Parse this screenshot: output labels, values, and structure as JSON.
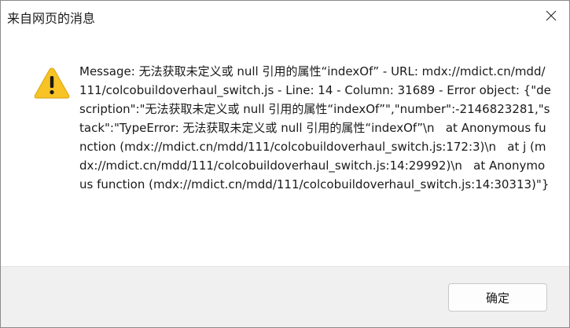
{
  "window": {
    "title": "来自网页的消息"
  },
  "icons": {
    "close": "close-icon",
    "warning": "warning-icon"
  },
  "message": {
    "text": "Message: 无法获取未定义或 null 引用的属性“indexOf” - URL: mdx://mdict.cn/mdd/111/colcobuildoverhaul_switch.js - Line: 14 - Column: 31689 - Error object: {\"description\":\"无法获取未定义或 null 引用的属性“indexOf”\",\"number\":-2146823281,\"stack\":\"TypeError: 无法获取未定义或 null 引用的属性“indexOf”\\n   at Anonymous function (mdx://mdict.cn/mdd/111/colcobuildoverhaul_switch.js:172:3)\\n   at j (mdx://mdict.cn/mdd/111/colcobuildoverhaul_switch.js:14:29992)\\n   at Anonymous function (mdx://mdict.cn/mdd/111/colcobuildoverhaul_switch.js:14:30313)\"}"
  },
  "buttons": {
    "ok_label": "确定"
  },
  "colors": {
    "warning_fill": "#f7c325",
    "warning_mark": "#1a1a1a",
    "footer_bg": "#f0f0f0"
  }
}
